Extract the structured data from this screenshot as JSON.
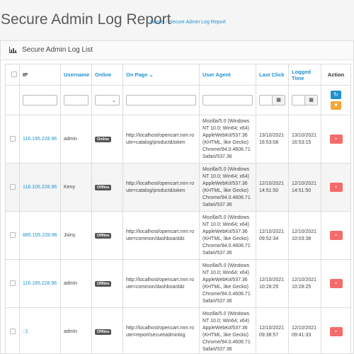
{
  "header": {
    "title": "Secure Admin Log Report",
    "breadcrumb": [
      "Home",
      "Secure Admin Log Report"
    ]
  },
  "panel": {
    "title": "Secure Admin Log List"
  },
  "columns": {
    "ip": "IP",
    "username": "Username",
    "online": "Online",
    "on_page": "On Page",
    "user_agent": "User Agent",
    "last_click": "Last Click",
    "logged_time_line1": "Logged",
    "logged_time_line2": "Time",
    "action": "Action"
  },
  "rows": [
    {
      "ip": "116.195.228.96",
      "username": "admin",
      "status": "Online",
      "page": "http://localhost/opencart.mm route=catalog/product&token",
      "ua": [
        "Mozilla/5.0 (Windows",
        "NT 10.0; Win64; x64)",
        "AppleWebKit/537.36",
        "(KHTML, like Gecko)",
        "Chrome/94.0.4606.71",
        "Safari/537.36"
      ],
      "last_click": [
        "13/10/2021",
        "16:53:08"
      ],
      "logged": [
        "13/10/2021",
        "16:53:15"
      ]
    },
    {
      "ip": "118.105.228.96",
      "username": "Keny",
      "status": "Offline",
      "page": "http://localhost/opencart.mm route=catalog/product&token",
      "ua": [
        "Mozilla/5.0 (Windows",
        "NT 10.0; Win64; x64)",
        "AppleWebKit/537.36",
        "(KHTML, like Gecko)",
        "Chrome/94.0.4606.71",
        "Safari/537.36"
      ],
      "last_click": [
        "12/10/2021",
        "14:51:50"
      ],
      "logged": [
        "12/10/2021",
        "14:51:50"
      ]
    },
    {
      "ip": "885.105.228.96",
      "username": "Joiny",
      "status": "Offline",
      "page": "http://localhost/opencart.mm route=common/dashboard&t",
      "ua": [
        "Mozilla/5.0 (Windows",
        "NT 10.0; Win64; x64)",
        "AppleWebKit/537.36",
        "(KHTML, like Gecko)",
        "Chrome/94.0.4606.71",
        "Safari/537.36"
      ],
      "last_click": [
        "12/10/2021",
        "09:52:34"
      ],
      "logged": [
        "12/10/2021",
        "10:03:38"
      ]
    },
    {
      "ip": "116.185.228.96",
      "username": "admin",
      "status": "Offline",
      "page": "http://localhost/opencart.mm route=common/dashboard&t",
      "ua": [
        "Mozilla/5.0 (Windows",
        "NT 10.0; Win64; x64)",
        "AppleWebKit/537.36",
        "(KHTML, like Gecko)",
        "Chrome/94.0.4606.71",
        "Safari/537.36"
      ],
      "last_click": [
        "12/10/2021",
        "10:28:25"
      ],
      "logged": [
        "12/10/2021",
        "10:28:25"
      ]
    },
    {
      "ip": "::1",
      "username": "admin",
      "status": "Offline",
      "page": "http://localhost/opencart.mm route=report/secureadminlog",
      "ua": [
        "Mozilla/5.0 (Windows",
        "NT 10.0; Win64; x64)",
        "AppleWebKit/537.36",
        "(KHTML, like Gecko)",
        "Chrome/94.0.4606.71",
        "Safari/537.36"
      ],
      "last_click": [
        "12/10/2021",
        "09:38:57"
      ],
      "logged": [
        "12/10/2021",
        "09:41:33"
      ]
    }
  ],
  "colors": {
    "link": "#1e91cf",
    "delete": "#f56b6b",
    "filter": "#f3a638",
    "badge": "#555555"
  },
  "icons": {
    "panel": "bar-chart-icon",
    "sort": "chevron-down-icon",
    "calendar": "calendar-icon",
    "refresh": "refresh-icon",
    "filter": "filter-icon",
    "delete": "trash-icon"
  }
}
